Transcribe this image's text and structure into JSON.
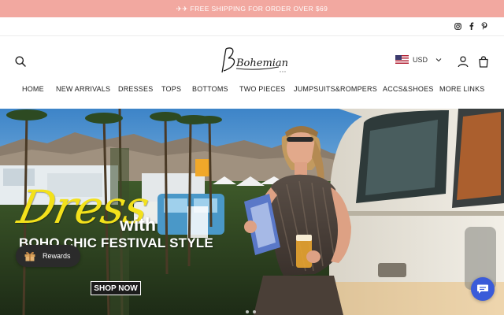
{
  "announcement": {
    "text": "✈✈ FREE SHIPPING FOR ORDER OVER $69"
  },
  "social": {
    "icons": [
      "instagram-icon",
      "facebook-icon",
      "pinterest-icon"
    ]
  },
  "header": {
    "logo_text": "Bohemian",
    "currency": {
      "code": "USD",
      "flag": "us-flag"
    }
  },
  "nav": {
    "items": [
      {
        "label": "HOME"
      },
      {
        "label": "NEW ARRIVALS"
      },
      {
        "label": "DRESSES"
      },
      {
        "label": "TOPS"
      },
      {
        "label": "BOTTOMS"
      },
      {
        "label": "TWO PIECES"
      },
      {
        "label": "JUMPSUITS&ROMPERS"
      },
      {
        "label": "ACCS&SHOES"
      },
      {
        "label": "MORE LINKS"
      }
    ]
  },
  "hero": {
    "script_word": "Dress",
    "with_word": "with",
    "subtitle": "BOHO CHIC FESTIVAL STYLE",
    "cta": "SHOP NOW"
  },
  "widgets": {
    "rewards_label": "Rewards"
  },
  "colors": {
    "announcement_bg": "#f2a8a0",
    "accent_yellow": "#f3e11b",
    "chat_blue": "#3a5bd9"
  }
}
